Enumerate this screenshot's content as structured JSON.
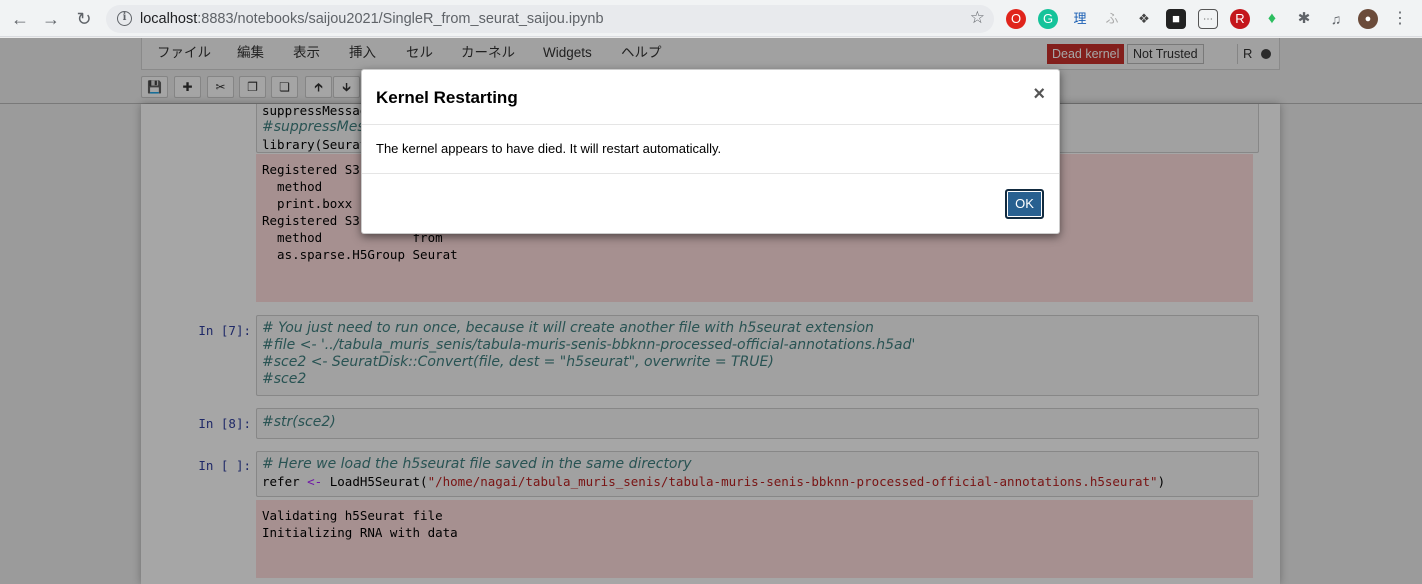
{
  "browser": {
    "url_host": "localhost",
    "url_path": ":8883/notebooks/saijou2021/SingleR_from_seurat_saijou.ipynb"
  },
  "menu": {
    "items": [
      "ファイル",
      "編集",
      "表示",
      "挿入",
      "セル",
      "カーネル",
      "Widgets",
      "ヘルプ"
    ]
  },
  "status": {
    "dead_kernel": "Dead kernel",
    "not_trusted": "Not Trusted",
    "kernel_name": "R"
  },
  "cells": {
    "cell0": {
      "lines": [
        "suppressMessages(",
        "#suppressMess",
        "library(Seurat"
      ],
      "output": [
        "Registered S3 method overwritten by 'spatstat':",
        "  method     from",
        "  print.boxx spatstat",
        "",
        "Registered S3 method overwritten by 'SeuratDisk':",
        "  method            from",
        "  as.sparse.H5Group Seurat"
      ]
    },
    "cell1": {
      "prompt": "In [7]:",
      "lines": [
        "# You just need to run once, because it will create another file with h5seurat extension",
        "#file <- '../tabula_muris_senis/tabula-muris-senis-bbknn-processed-official-annotations.h5ad'",
        "#sce2 <- SeuratDisk::Convert(file, dest = \"h5seurat\", overwrite = TRUE)",
        "#sce2"
      ]
    },
    "cell2": {
      "prompt": "In [8]:",
      "lines": [
        "#str(sce2)"
      ]
    },
    "cell3": {
      "prompt": "In [ ]:",
      "comment": "# Here we load the h5seurat file saved in the same directory",
      "code_pre": "refer ",
      "code_op": "<-",
      "code_fn": " LoadH5Seurat(",
      "code_str": "\"/home/nagai/tabula_muris_senis/tabula-muris-senis-bbknn-processed-official-annotations.h5seurat\"",
      "code_post": ")",
      "output": [
        "Validating h5Seurat file",
        "",
        "Initializing RNA with data"
      ]
    }
  },
  "modal": {
    "title": "Kernel Restarting",
    "close": "×",
    "body": "The kernel appears to have died. It will restart automatically.",
    "ok": "OK"
  }
}
